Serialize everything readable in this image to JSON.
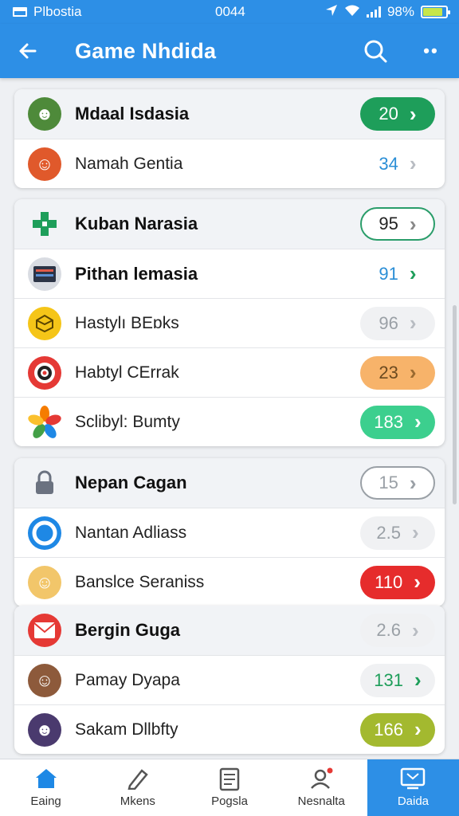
{
  "status_bar": {
    "app_name": "Plbostia",
    "time": "0044",
    "battery_text": "98%",
    "icons": [
      "location-arrow-icon",
      "wifi-icon",
      "signal-icon",
      "battery-icon"
    ]
  },
  "app_bar": {
    "title": "Game Nhdida",
    "back_icon": "arrow-left-icon",
    "search_icon": "search-icon",
    "more_icon": "more-dots-icon",
    "more_glyph": "••"
  },
  "cards": [
    {
      "rows": [
        {
          "label": "Mdaal Isdasia",
          "value": "20",
          "head": true,
          "icon": "game-avatar-icon",
          "icon_bg": "#4e8a3a",
          "pill_bg": "#1e9e5a",
          "text_color": "#ffffff",
          "chev_color": "#ffffff",
          "pill_border": ""
        },
        {
          "label": "Namah Gentia",
          "value": "34",
          "head": false,
          "icon": "character-icon",
          "icon_bg": "#e0592b",
          "pill_bg": "",
          "text_color": "#2a8ed6",
          "chev_color": "#b8bcc2",
          "pill_border": ""
        }
      ]
    },
    {
      "rows": [
        {
          "label": "Kuban Narasia",
          "value": "95",
          "head": true,
          "icon": "puzzle-cross-icon",
          "icon_bg": "",
          "pill_bg": "#ffffff",
          "text_color": "#222222",
          "chev_color": "#888888",
          "pill_border": "#2a9d6a"
        },
        {
          "label": "Pithan lemasia",
          "value": "91",
          "head": true,
          "icon": "card-stack-icon",
          "icon_bg": "#3a4356",
          "pill_bg": "",
          "text_color": "#2a8ed6",
          "chev_color": "#1e9e5a",
          "pill_border": ""
        },
        {
          "label": "Hastylı BEɒks",
          "value": "96",
          "head": false,
          "icon": "box-icon",
          "icon_bg": "#f5c518",
          "pill_bg": "#f0f1f3",
          "text_color": "#9aa0a6",
          "chev_color": "#b8bcc2",
          "pill_border": ""
        },
        {
          "label": "Habtyl CErrak",
          "value": "23",
          "head": false,
          "icon": "target-icon",
          "icon_bg": "#e53935",
          "pill_bg": "#f7b36a",
          "text_color": "#6b4a20",
          "chev_color": "#9a6a30",
          "pill_border": ""
        },
        {
          "label": "Sclibyl: Bumty",
          "value": "183",
          "head": false,
          "icon": "flower-icon",
          "icon_bg": "",
          "pill_bg": "#3ccf8e",
          "text_color": "#ffffff",
          "chev_color": "#ffffff",
          "pill_border": ""
        }
      ]
    },
    {
      "rows": [
        {
          "label": "Nepan Cagan",
          "value": "15",
          "head": true,
          "icon": "lock-icon",
          "icon_bg": "",
          "pill_bg": "#ffffff",
          "text_color": "#9aa0a6",
          "chev_color": "#9aa0a6",
          "pill_border": "#9aa0a6"
        },
        {
          "label": "Nantan Adliass",
          "value": "2.5",
          "head": false,
          "icon": "ring-icon",
          "icon_bg": "#1e88e5",
          "pill_bg": "#f0f1f3",
          "text_color": "#9aa0a6",
          "chev_color": "#b8bcc2",
          "pill_border": ""
        },
        {
          "label": "Banslce Seraniss",
          "value": "110",
          "head": false,
          "icon": "face-avatar-icon",
          "icon_bg": "#f2c66a",
          "pill_bg": "#e62c2c",
          "text_color": "#ffffff",
          "chev_color": "#ffffff",
          "pill_border": ""
        }
      ]
    },
    {
      "rows": [
        {
          "label": "Bergin Guga",
          "value": "2.6",
          "head": true,
          "icon": "mail-icon",
          "icon_bg": "#e53935",
          "pill_bg": "#f0f1f3",
          "text_color": "#9aa0a6",
          "chev_color": "#b8bcc2",
          "pill_border": ""
        },
        {
          "label": "Pamay Dyapa",
          "value": "131",
          "head": false,
          "icon": "person-avatar-icon",
          "icon_bg": "#8d5a3b",
          "pill_bg": "#f0f1f3",
          "text_color": "#1e9e5a",
          "chev_color": "#1e9e5a",
          "pill_border": ""
        },
        {
          "label": "Sakam Dllbfty",
          "value": "166",
          "head": false,
          "icon": "pet-avatar-icon",
          "icon_bg": "#4a3a6e",
          "pill_bg": "#a3b92f",
          "text_color": "#ffffff",
          "chev_color": "#ffffff",
          "pill_border": ""
        }
      ]
    }
  ],
  "bottom_nav": [
    {
      "label": "Eaing",
      "icon": "home-icon",
      "active": false
    },
    {
      "label": "Mkens",
      "icon": "pencil-icon",
      "active": false
    },
    {
      "label": "Pogsla",
      "icon": "list-document-icon",
      "active": false
    },
    {
      "label": "Nesnalta",
      "icon": "profile-notification-icon",
      "active": false
    },
    {
      "label": "Daida",
      "icon": "screen-icon",
      "active": true
    }
  ],
  "colors": {
    "primary": "#2d8fe6",
    "background": "#eef0f3"
  }
}
